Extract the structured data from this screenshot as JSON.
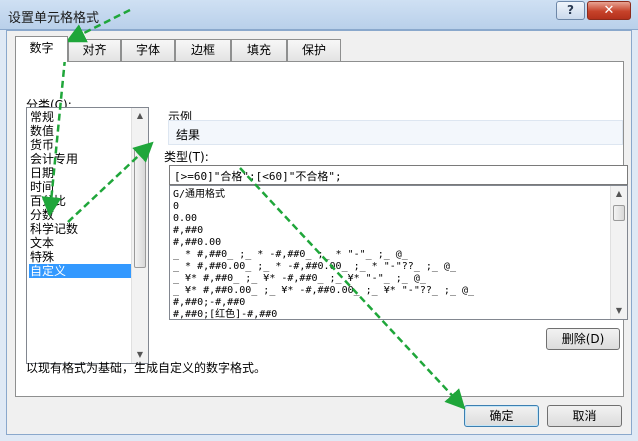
{
  "window": {
    "title": "设置单元格格式",
    "help_label": "?",
    "close_label": "✕"
  },
  "tabs": [
    {
      "label": "数字",
      "active": true
    },
    {
      "label": "对齐",
      "active": false
    },
    {
      "label": "字体",
      "active": false
    },
    {
      "label": "边框",
      "active": false
    },
    {
      "label": "填充",
      "active": false
    },
    {
      "label": "保护",
      "active": false
    }
  ],
  "category": {
    "label": "分类(C):",
    "items": [
      "常规",
      "数值",
      "货币",
      "会计专用",
      "日期",
      "时间",
      "百分比",
      "分数",
      "科学记数",
      "文本",
      "特殊",
      "自定义"
    ],
    "selected": "自定义"
  },
  "sample": {
    "label": "示例",
    "value": "结果"
  },
  "type": {
    "label": "类型(T):",
    "value": "[>=60]\"合格\";[<60]\"不合格\";",
    "formats": [
      "G/通用格式",
      "0",
      "0.00",
      "#,##0",
      "#,##0.00",
      "_ * #,##0_ ;_ * -#,##0_ ;_ * \"-\"_ ;_ @_",
      "_ * #,##0.00_ ;_ * -#,##0.00_ ;_ * \"-\"??_ ;_ @_",
      "_ ¥* #,##0_ ;_ ¥* -#,##0_ ;_ ¥* \"-\"_ ;_ @_",
      "_ ¥* #,##0.00_ ;_ ¥* -#,##0.00_ ;_ ¥* \"-\"??_ ;_ @_",
      "#,##0;-#,##0",
      "#,##0;[红色]-#,##0"
    ]
  },
  "buttons": {
    "delete": "删除(D)",
    "ok": "确定",
    "cancel": "取消"
  },
  "description": "以现有格式为基础，生成自定义的数字格式。",
  "colors": {
    "selection": "#3399ff",
    "annotation_arrow": "#1fa63a",
    "close_button": "#c6422a"
  }
}
